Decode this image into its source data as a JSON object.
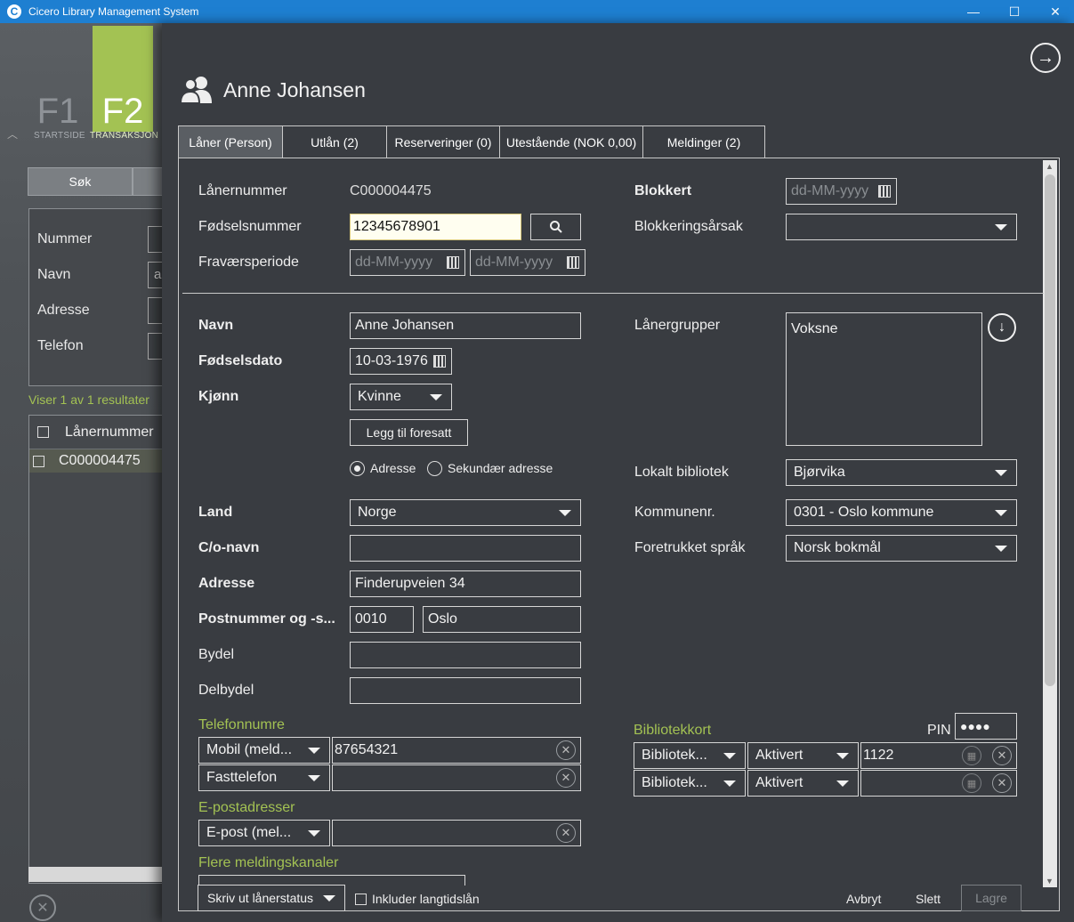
{
  "window": {
    "title": "Cicero Library Management System",
    "minimize": "—",
    "maximize": "☐",
    "close": "✕"
  },
  "nav": {
    "f1": "F1",
    "f2": "F2",
    "f1_caption": "STARTSIDE",
    "f2_caption": "TRANSAKSJON",
    "tabs": [
      "Søk"
    ],
    "fields": [
      {
        "label": "Nummer",
        "value": ""
      },
      {
        "label": "Navn",
        "value": "a"
      },
      {
        "label": "Adresse",
        "value": ""
      },
      {
        "label": "Telefon",
        "value": ""
      }
    ],
    "results_text": "Viser 1 av 1 resultater",
    "grid_header": "Lånernummer",
    "grid_rows": [
      "C000004475"
    ]
  },
  "header": {
    "title": "Anne Johansen"
  },
  "tabs": [
    {
      "label": "Låner (Person)",
      "active": true
    },
    {
      "label": "Utlån (2)"
    },
    {
      "label": "Reserveringer (0)"
    },
    {
      "label": "Utestående (NOK 0,00)"
    },
    {
      "label": "Meldinger (2)"
    }
  ],
  "top": {
    "lanernummer_label": "Lånernummer",
    "lanernummer_value": "C000004475",
    "fodselsnummer_label": "Fødselsnummer",
    "fodselsnummer_value": "12345678901",
    "fravaer_label": "Fraværsperiode",
    "date_placeholder": "dd-MM-yyyy",
    "blokkert_label": "Blokkert",
    "blokkeringsarsak_label": "Blokkeringsårsak"
  },
  "person": {
    "navn_label": "Navn",
    "navn_value": "Anne Johansen",
    "fodselsdato_label": "Fødselsdato",
    "fodselsdato_value": "10-03-1976",
    "kjonn_label": "Kjønn",
    "kjonn_value": "Kvinne",
    "add_guardian": "Legg til foresatt",
    "address_radio": "Adresse",
    "secondary_radio": "Sekundær adresse",
    "land_label": "Land",
    "land_value": "Norge",
    "co_label": "C/o-navn",
    "co_value": "",
    "adresse_label": "Adresse",
    "adresse_value": "Finderupveien 34",
    "post_label": "Postnummer og -s...",
    "postnr_value": "0010",
    "poststed_value": "Oslo",
    "bydel_label": "Bydel",
    "delbydel_label": "Delbydel"
  },
  "right": {
    "lanergrupper_label": "Lånergrupper",
    "lanergrupper_value": "Voksne",
    "lokalt_label": "Lokalt bibliotek",
    "lokalt_value": "Bjørvika",
    "kommune_label": "Kommunenr.",
    "kommune_value": "0301 - Oslo kommune",
    "sprak_label": "Foretrukket språk",
    "sprak_value": "Norsk bokmål"
  },
  "phones": {
    "heading": "Telefonnumre",
    "rows": [
      {
        "type": "Mobil (meld...",
        "number": "87654321"
      },
      {
        "type": "Fasttelefon",
        "number": ""
      }
    ]
  },
  "emails": {
    "heading": "E-postadresser",
    "rows": [
      {
        "type": "E-post (mel...",
        "address": ""
      }
    ]
  },
  "channels": {
    "heading": "Flere meldingskanaler"
  },
  "cards": {
    "heading": "Bibliotekkort",
    "pin_label": "PIN",
    "pin_value": "●●●●",
    "rows": [
      {
        "type": "Bibliotek...",
        "status": "Aktivert",
        "number": "1122"
      },
      {
        "type": "Bibliotek...",
        "status": "Aktivert",
        "number": ""
      }
    ]
  },
  "footer": {
    "print_label": "Skriv ut lånerstatus",
    "include_label": "Inkluder langtidslån",
    "cancel": "Avbryt",
    "delete": "Slett",
    "save": "Lagre"
  }
}
